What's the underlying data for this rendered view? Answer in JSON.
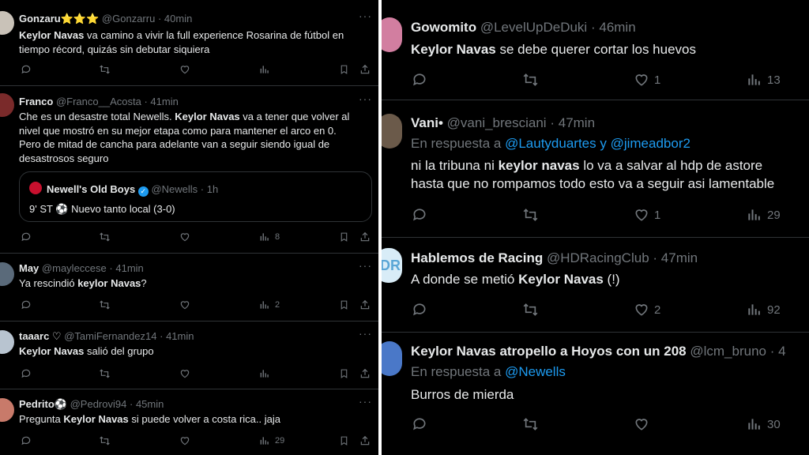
{
  "left": {
    "tweets": [
      {
        "name": "Gonzaru",
        "badge": "⭐⭐⭐",
        "handle": "@Gonzarru",
        "sep": "·",
        "time": "40min",
        "t1": "Keylor Navas",
        "t2": " va camino a vivir la full experience Rosarina de fútbol en tiempo récord, quizás sin debutar siquiera",
        "views": ""
      },
      {
        "name": "Franco",
        "handle": "@Franco__Acosta",
        "sep": "·",
        "time": "41min",
        "t1": "Che es un desastre total Newells. ",
        "t2": "Keylor Navas",
        "t3": " va a tener que volver al nivel que mostró en su mejor etapa como para mantener el arco en 0. Pero de mitad de cancha para adelante van a seguir siendo igual de desastrosos seguro",
        "quote": {
          "name": "Newell's Old Boys",
          "handle": "@Newells",
          "sep": "·",
          "time": "1h",
          "text": "9' ST ⚽ Nuevo tanto local (3-0)"
        },
        "views": "8"
      },
      {
        "name": "May",
        "handle": "@mayleccese",
        "sep": "·",
        "time": "41min",
        "t1": "Ya rescindió ",
        "t2": "keylor Navas",
        "t3": "?",
        "views": "2"
      },
      {
        "name": "taaarc ♡",
        "handle": "@TamiFernandez14",
        "sep": "·",
        "time": "41min",
        "t1": "Keylor Navas",
        "t2": " salió del grupo",
        "views": ""
      },
      {
        "name": "Pedrito⚽",
        "handle": "@Pedrovi94",
        "sep": "·",
        "time": "45min",
        "t1": "Pregunta ",
        "t2": "Keylor Navas",
        "t3": " si puede volver a costa rica.. jaja",
        "views": "29"
      }
    ]
  },
  "right": {
    "tweets": [
      {
        "name": "Gowomito",
        "handle": "@LevelUpDeDuki",
        "sep": "·",
        "time": "46min",
        "t1": "Keylor Navas",
        "t2": " se debe querer cortar los huevos",
        "likes": "1",
        "views": "13"
      },
      {
        "name": "Vani•",
        "handle": "@vani_bresciani",
        "sep": "·",
        "time": "47min",
        "reply_prefix": "En respuesta a ",
        "reply_to": "@Lautyduartes y @jimeadbor2",
        "l1a": "ni la tribuna ni ",
        "l1b": "keylor navas",
        "l1c": " lo va a salvar al hdp de astore",
        "l2": "hasta que no rompamos todo esto va a seguir asi lamentable",
        "likes": "1",
        "views": "29"
      },
      {
        "name": "Hablemos de Racing",
        "handle": "@HDRacingClub",
        "sep": "·",
        "time": "47min",
        "avatar_text": "DR",
        "t1": "A donde se metió ",
        "t2": "Keylor Navas",
        "t3": " (!)",
        "likes": "2",
        "views": "92"
      },
      {
        "name": "Keylor Navas atropello a Hoyos con un 208",
        "handle": "@lcm_bruno",
        "sep": "·",
        "time": "4",
        "reply_prefix": "En respuesta a ",
        "reply_to": "@Newells",
        "t1": "Burros de mierda",
        "likes": "",
        "views": "30"
      }
    ]
  },
  "icons": [
    "reply-icon",
    "retweet-icon",
    "like-icon",
    "views-icon",
    "bookmark-icon",
    "share-icon",
    "more-icon"
  ]
}
